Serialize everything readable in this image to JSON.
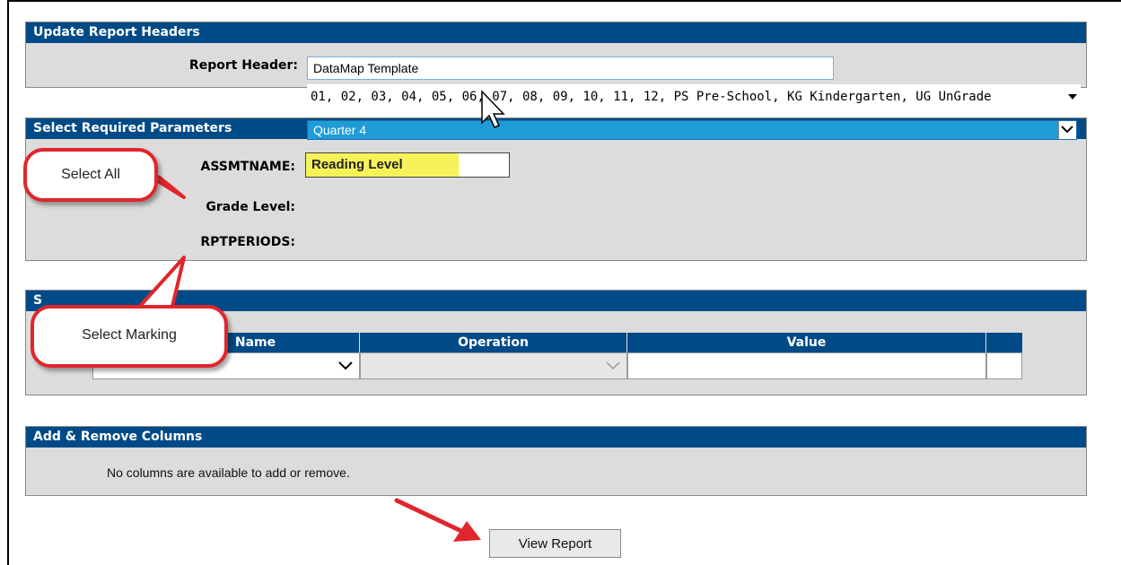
{
  "report_headers": {
    "section_title": "Update Report Headers",
    "report_header_label": "Report Header:",
    "report_header_value": "DataMap Template"
  },
  "required_params": {
    "section_title": "Select Required Parameters",
    "assmtname_label": "ASSMTNAME:",
    "assmtname_value": "Reading Level",
    "grade_level_label": "Grade Level:",
    "grade_level_value": "01, 02, 03, 04, 05, 06, 07, 08, 09, 10, 11, 12, PS Pre-School, KG Kindergarten, UG UnGrade",
    "rptperiods_label": "RPTPERIODS:",
    "rptperiods_value": "Quarter 4"
  },
  "filters": {
    "section_title_partial": "S",
    "col_name_partial": "Name",
    "col_operation": "Operation",
    "col_value": "Value"
  },
  "columns": {
    "section_title": "Add & Remove Columns",
    "message": "No columns are available to add or remove."
  },
  "view_report_label": "View Report",
  "callouts": {
    "select_all": "Select All",
    "select_marking": "Select Marking"
  },
  "colors": {
    "header_blue": "#004b87",
    "callout_red": "#e0262c",
    "highlight_yellow": "#f6f35a",
    "selected_blue": "#1e9cd7"
  }
}
